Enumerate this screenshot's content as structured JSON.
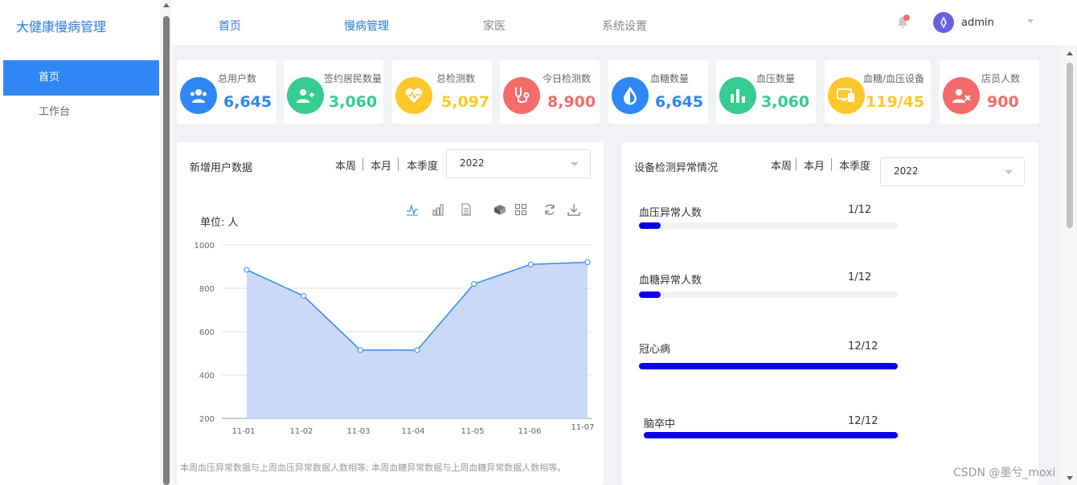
{
  "app": {
    "title": "大健康慢病管理"
  },
  "sidebar": {
    "items": [
      {
        "label": "首页",
        "active": true
      },
      {
        "label": "工作台",
        "active": false
      }
    ]
  },
  "topnav": {
    "tabs": [
      {
        "label": "首页"
      },
      {
        "label": "慢病管理"
      },
      {
        "label": "家医"
      },
      {
        "label": "系统设置"
      }
    ],
    "user": {
      "name": "admin"
    },
    "icons": {
      "bell": "bell-icon",
      "avatar": "avatar-icon"
    }
  },
  "stats": [
    {
      "label": "总用户数",
      "value": "6,645",
      "color": "#2f87f5",
      "icon": "users-icon"
    },
    {
      "label": "签约居民数量",
      "value": "3,060",
      "color": "#36cc8f",
      "icon": "user-add-icon"
    },
    {
      "label": "总检测数",
      "value": "5,097",
      "color": "#ffc82c",
      "icon": "heart-pulse-icon"
    },
    {
      "label": "今日检测数",
      "value": "8,900",
      "color": "#f56c6c",
      "icon": "stethoscope-icon"
    },
    {
      "label": "血糖数量",
      "value": "6,645",
      "color": "#2f87f5",
      "icon": "drop-icon"
    },
    {
      "label": "血压数量",
      "value": "3,060",
      "color": "#36cc8f",
      "icon": "bar-chart-icon"
    },
    {
      "label": "血糖/血压设备",
      "value": "119/45",
      "color": "#ffc82c",
      "icon": "device-icon"
    },
    {
      "label": "店员人数",
      "value": "900",
      "color": "#f56c6c",
      "icon": "user-remove-icon"
    }
  ],
  "new_users_panel": {
    "title": "新增用户数据",
    "periods": [
      "本周",
      "本月",
      "本季度"
    ],
    "year_select": "2022",
    "unit": "单位: 人",
    "footnote": "本周血压异常数据与上周血压异常数据人数相等; 本周血糖异常数据与上周血糖异常数据人数相等。",
    "toolbox": [
      "line-switch-icon",
      "bar-switch-icon",
      "data-view-icon",
      "stack-icon",
      "tiled-icon",
      "restore-icon",
      "download-icon"
    ]
  },
  "device_panel": {
    "title": "设备检测异常情况",
    "periods": [
      "本周",
      "本月",
      "本季度"
    ],
    "year_select": "2022",
    "rows": [
      {
        "label": "血压异常人数",
        "value": "1/12",
        "fraction": 0.083
      },
      {
        "label": "血糖异常人数",
        "value": "1/12",
        "fraction": 0.083
      },
      {
        "label": "冠心病",
        "value": "12/12",
        "fraction": 1.0
      },
      {
        "label": "脑卒中",
        "value": "12/12",
        "fraction": 1.0
      }
    ]
  },
  "chart_data": {
    "type": "area",
    "categories": [
      "11-01",
      "11-02",
      "11-03",
      "11-04",
      "11-05",
      "11-06",
      "11-07"
    ],
    "values": [
      885,
      765,
      515,
      515,
      820,
      910,
      920
    ],
    "ylim": [
      200,
      1000
    ],
    "yticks": [
      "1000",
      "800",
      "600",
      "400",
      "200"
    ],
    "ylabel": "单位: 人",
    "grid": true,
    "colors": {
      "line": "#2f8cf0",
      "area": "#c9d9f7"
    }
  },
  "watermark": "CSDN @墨兮_moxi"
}
